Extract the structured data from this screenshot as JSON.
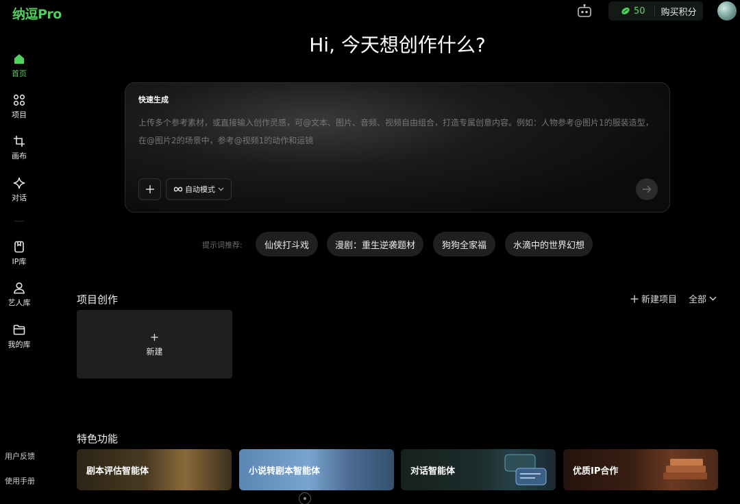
{
  "app": {
    "logo": "纳逗Pro"
  },
  "topbar": {
    "credits": "50",
    "buy_label": "购买积分"
  },
  "sidebar": {
    "items": [
      {
        "label": "首页",
        "icon": "home-icon",
        "active": true
      },
      {
        "label": "项目",
        "icon": "grid-dots-icon"
      },
      {
        "label": "画布",
        "icon": "crop-icon"
      },
      {
        "label": "对话",
        "icon": "sparkle-icon"
      },
      {
        "label": "IP库",
        "icon": "bookmark-icon"
      },
      {
        "label": "艺人库",
        "icon": "user-icon"
      },
      {
        "label": "我的库",
        "icon": "folder-icon"
      }
    ],
    "bottom": {
      "feedback": "用户反馈",
      "manual": "使用手册"
    }
  },
  "hero": {
    "title": "Hi, 今天想创作什么?"
  },
  "quick": {
    "label": "快速生成",
    "placeholder": "上传多个参考素材，或直接输入创作灵感，可@文本、图片、音频、视频自由组合，打造专属创意内容。例如：人物参考@图片1的服装造型，在@图片2的场景中，参考@视频1的动作和运镜",
    "mode_label": "自动模式"
  },
  "suggestions": {
    "label": "提示词推荐:",
    "chips": [
      "仙侠打斗戏",
      "漫剧：重生逆袭题材",
      "狗狗全家福",
      "水滴中的世界幻想"
    ]
  },
  "projects": {
    "title": "项目创作",
    "new_project": "新建项目",
    "filter": "全部",
    "new_card": "新建"
  },
  "features": {
    "title": "特色功能",
    "cards": [
      "剧本评估智能体",
      "小说转剧本智能体",
      "对话智能体",
      "优质IP合作"
    ]
  },
  "colors": {
    "accent": "#52d061",
    "background": "#000000"
  }
}
